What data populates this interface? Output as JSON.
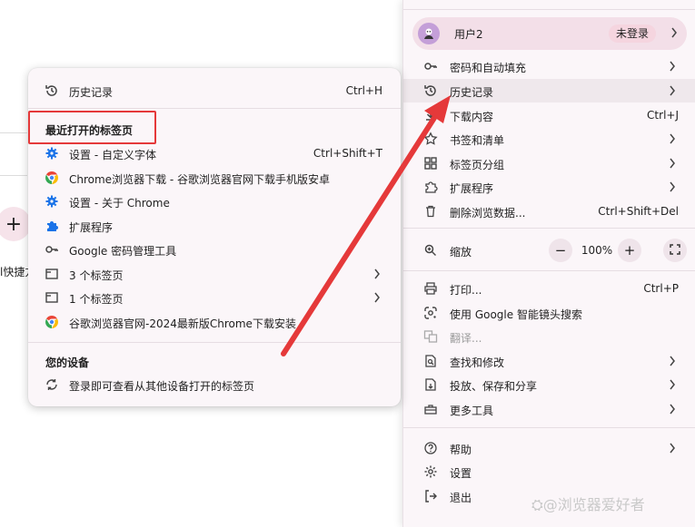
{
  "background": {
    "side_label": "l快捷方"
  },
  "menu": {
    "profile": {
      "name": "用户2",
      "status": "未登录"
    },
    "items": [
      {
        "label": "密码和自动填充",
        "shortcut": "",
        "icon": "key-icon",
        "has_submenu": true
      },
      {
        "label": "历史记录",
        "shortcut": "",
        "icon": "history-icon",
        "has_submenu": true,
        "highlighted": true
      },
      {
        "label": "下载内容",
        "shortcut": "Ctrl+J",
        "icon": "download-icon",
        "has_submenu": false
      },
      {
        "label": "书签和清单",
        "shortcut": "",
        "icon": "star-icon",
        "has_submenu": true
      },
      {
        "label": "标签页分组",
        "shortcut": "",
        "icon": "grid-icon",
        "has_submenu": true
      },
      {
        "label": "扩展程序",
        "shortcut": "",
        "icon": "puzzle-icon",
        "has_submenu": true
      },
      {
        "label": "删除浏览数据...",
        "shortcut": "Ctrl+Shift+Del",
        "icon": "trash-icon",
        "has_submenu": false
      }
    ],
    "zoom": {
      "label": "缩放",
      "value": "100%",
      "minus": "−",
      "plus": "+"
    },
    "items2": [
      {
        "label": "打印...",
        "shortcut": "Ctrl+P",
        "icon": "printer-icon",
        "has_submenu": false
      },
      {
        "label": "使用 Google 智能镜头搜索",
        "shortcut": "",
        "icon": "lens-icon",
        "has_submenu": false
      },
      {
        "label": "翻译...",
        "shortcut": "",
        "icon": "translate-icon",
        "has_submenu": false,
        "disabled": true
      },
      {
        "label": "查找和修改",
        "shortcut": "",
        "icon": "find-icon",
        "has_submenu": true
      },
      {
        "label": "投放、保存和分享",
        "shortcut": "",
        "icon": "cast-icon",
        "has_submenu": true
      },
      {
        "label": "更多工具",
        "shortcut": "",
        "icon": "toolbox-icon",
        "has_submenu": true
      }
    ],
    "items3": [
      {
        "label": "帮助",
        "shortcut": "",
        "icon": "help-icon",
        "has_submenu": true
      },
      {
        "label": "设置",
        "shortcut": "",
        "icon": "gear-icon",
        "has_submenu": false
      },
      {
        "label": "退出",
        "shortcut": "",
        "icon": "exit-icon",
        "has_submenu": false
      }
    ]
  },
  "history_submenu": {
    "history_item": {
      "label": "历史记录",
      "shortcut": "Ctrl+H"
    },
    "recent_heading": "最近打开的标签页",
    "recent": [
      {
        "label": "设置 - 自定义字体",
        "shortcut": "Ctrl+Shift+T",
        "icon": "gear-icon",
        "has_submenu": false
      },
      {
        "label": "Chrome浏览器下载 - 谷歌浏览器官网下载手机版安卓",
        "shortcut": "",
        "icon": "chrome-icon",
        "has_submenu": false
      },
      {
        "label": "设置 - 关于 Chrome",
        "shortcut": "",
        "icon": "gear-icon",
        "has_submenu": false
      },
      {
        "label": "扩展程序",
        "shortcut": "",
        "icon": "puzzle-icon",
        "has_submenu": false
      },
      {
        "label": "Google 密码管理工具",
        "shortcut": "",
        "icon": "key-icon",
        "has_submenu": false
      },
      {
        "label": "3 个标签页",
        "shortcut": "",
        "icon": "window-icon",
        "has_submenu": true
      },
      {
        "label": "1 个标签页",
        "shortcut": "",
        "icon": "window-icon",
        "has_submenu": true
      },
      {
        "label": "谷歌浏览器官网-2024最新版Chrome下载安装",
        "shortcut": "",
        "icon": "chrome-icon",
        "has_submenu": false
      }
    ],
    "devices_heading": "您的设备",
    "devices_item": {
      "label": "登录即可查看从其他设备打开的标签页",
      "icon": "sync-icon"
    }
  },
  "watermark": "⛭@浏览器爱好者",
  "colors": {
    "highlight_box": "#e5393a",
    "arrow": "#e5393a",
    "menu_bg": "#fbf6f9",
    "profile_bg": "#f3dfe8",
    "accent_blue": "#1a73e8"
  }
}
